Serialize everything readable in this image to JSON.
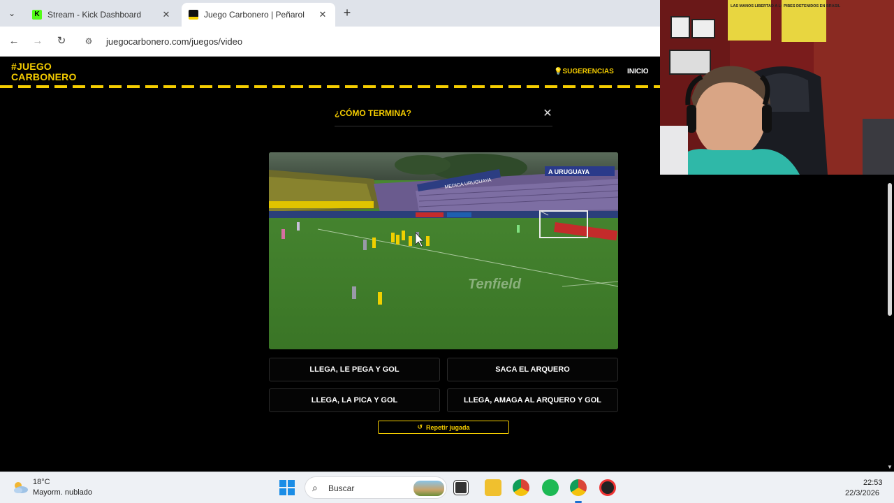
{
  "browser": {
    "tabs": [
      {
        "label": "Stream - Kick Dashboard",
        "favicon": "kick-icon"
      },
      {
        "label": "Juego Carbonero | Peñarol",
        "favicon": "juego-carbonero-icon"
      }
    ],
    "url": "juegocarbonero.com/juegos/video"
  },
  "site": {
    "logo_line1": "#JUEGO",
    "logo_line2": "CARBONERO",
    "nav": {
      "suggestions": "SUGERENCIAS",
      "home": "INICIO"
    },
    "accent": "#f5cd00"
  },
  "game": {
    "title": "¿CÓMO TERMINA?",
    "watermark": "Tenfield",
    "stadium_banner": "A URUGUAYA",
    "ad_banner": "MEDICA URUGUAYA",
    "options": [
      "LLEGA, LE PEGA Y GOL",
      "SACA EL ARQUERO",
      "LLEGA, LA PICA Y GOL",
      "LLEGA, AMAGA AL ARQUERO Y GOL"
    ],
    "replay": "Repetir jugada"
  },
  "webcam": {
    "poster1": "LAS MANOS LIBERTAD A LOS PIBES",
    "poster2": "PIBES DETENIDOS EN BRASIL"
  },
  "taskbar": {
    "weather_temp": "18°C",
    "weather_desc": "Mayorm. nublado",
    "search_placeholder": "Buscar",
    "time": "22:53",
    "date": "22/3/2026"
  }
}
